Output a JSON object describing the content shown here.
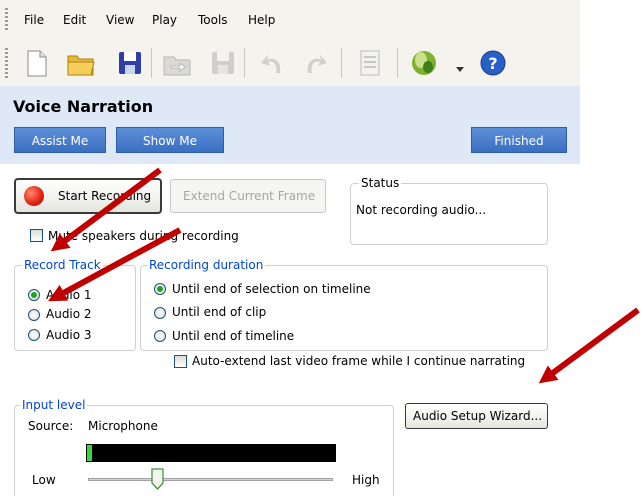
{
  "menu": [
    "File",
    "Edit",
    "View",
    "Play",
    "Tools",
    "Help"
  ],
  "toolbar": {
    "icons": [
      "new-document-icon",
      "open-folder-icon",
      "save-icon",
      "import-icon",
      "save-disabled-icon",
      "undo-icon",
      "redo-icon",
      "checklist-icon",
      "video-effects-icon",
      "help-icon"
    ]
  },
  "header": {
    "title": "Voice Narration",
    "assist_label": "Assist Me",
    "show_label": "Show Me",
    "finished_label": "Finished"
  },
  "recording": {
    "start_label": "Start Recording",
    "extend_label": "Extend Current Frame",
    "mute_label": "Mute speakers during recording",
    "mute_checked": false
  },
  "status": {
    "legend": "Status",
    "text": "Not recording audio..."
  },
  "record_track": {
    "legend": "Record Track",
    "options": [
      "Audio 1",
      "Audio 2",
      "Audio 3"
    ],
    "selected": "Audio 1"
  },
  "recording_duration": {
    "legend": "Recording duration",
    "options": [
      "Until end of selection on timeline",
      "Until end of clip",
      "Until end of timeline"
    ],
    "selected": "Until end of selection on timeline",
    "auto_extend_label": "Auto-extend last video frame while I continue narrating",
    "auto_extend_checked": false
  },
  "input_level": {
    "legend": "Input level",
    "source_label": "Source:",
    "source_value": "Microphone",
    "level_fraction": 0.02,
    "low_label": "Low",
    "high_label": "High",
    "slider_fraction": 0.28
  },
  "wizard_label": "Audio Setup Wizard...",
  "colors": {
    "accent_blue": "#3a6fc2",
    "header_bg": "#dfe8f6",
    "legend_blue": "#0046d5",
    "arrow_red": "#c00000"
  }
}
